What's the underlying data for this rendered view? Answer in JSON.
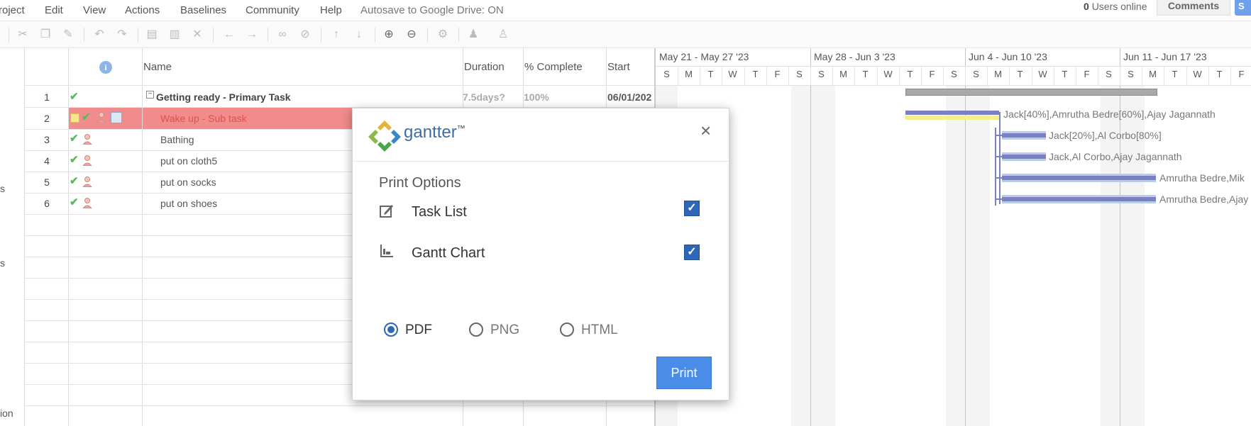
{
  "menubar": {
    "items": [
      "roject",
      "Edit",
      "View",
      "Actions",
      "Baselines",
      "Community",
      "Help"
    ],
    "autosave": "Autosave to Google Drive: ON",
    "users_online_count": "0",
    "users_online_label": "Users online",
    "comments_label": "Comments",
    "share_label": "S"
  },
  "toolbar": {
    "icons": [
      "cut-icon",
      "copy-icon",
      "paste-format-icon",
      "undo-icon",
      "redo-icon",
      "insert-task-icon",
      "insert-subtask-icon",
      "delete-icon",
      "outdent-icon",
      "indent-icon",
      "link-icon",
      "unlink-icon",
      "move-up-icon",
      "move-down-icon",
      "zoom-in-icon",
      "zoom-out-icon",
      "settings-icon",
      "assign-resource-icon",
      "add-resource-icon"
    ]
  },
  "grid": {
    "headers": {
      "name": "Name",
      "duration": "Duration",
      "complete": "% Complete",
      "start": "Start",
      "info": "i"
    },
    "parent": {
      "num": "1",
      "name": "Getting ready - Primary Task",
      "duration": "7.5days?",
      "complete": "100%",
      "start": "06/01/202"
    },
    "rows": [
      {
        "num": "2",
        "name": "Wake up - Sub task"
      },
      {
        "num": "3",
        "name": "Bathing"
      },
      {
        "num": "4",
        "name": "put on cloth5"
      },
      {
        "num": "5",
        "name": "put on socks"
      },
      {
        "num": "6",
        "name": "put on shoes"
      }
    ],
    "left_labels": [
      "s",
      "s",
      "ion"
    ]
  },
  "gantt": {
    "weeks": [
      "May 21 - May 27 '23",
      "May 28 - Jun 3 '23",
      "Jun 4 - Jun 10 '23",
      "Jun 11 - Jun 17 '23"
    ],
    "days": [
      "S",
      "M",
      "T",
      "W",
      "T",
      "F",
      "S",
      "S",
      "M",
      "T",
      "W",
      "T",
      "F",
      "S",
      "S",
      "M",
      "T",
      "W",
      "T",
      "F",
      "S",
      "S",
      "M",
      "T",
      "W",
      "T",
      "F"
    ],
    "resource_labels": [
      "Jack[40%],Amrutha Bedre[60%],Ajay Jagannath",
      "Jack[20%],Al Corbo[80%]",
      "Jack,Al Corbo,Ajay Jagannath",
      "Amrutha Bedre,Mik",
      "Amrutha Bedre,Ajay"
    ]
  },
  "modal": {
    "logo_text": "gantter",
    "logo_tm": "™",
    "close": "×",
    "title": "Print Options",
    "options": [
      {
        "label": "Task List",
        "checked": true
      },
      {
        "label": "Gantt Chart",
        "checked": true
      }
    ],
    "formats": [
      "PDF",
      "PNG",
      "HTML"
    ],
    "selected_format": "PDF",
    "print_label": "Print",
    "check_mark": "✓",
    "accent_color": "#2e67b7"
  }
}
